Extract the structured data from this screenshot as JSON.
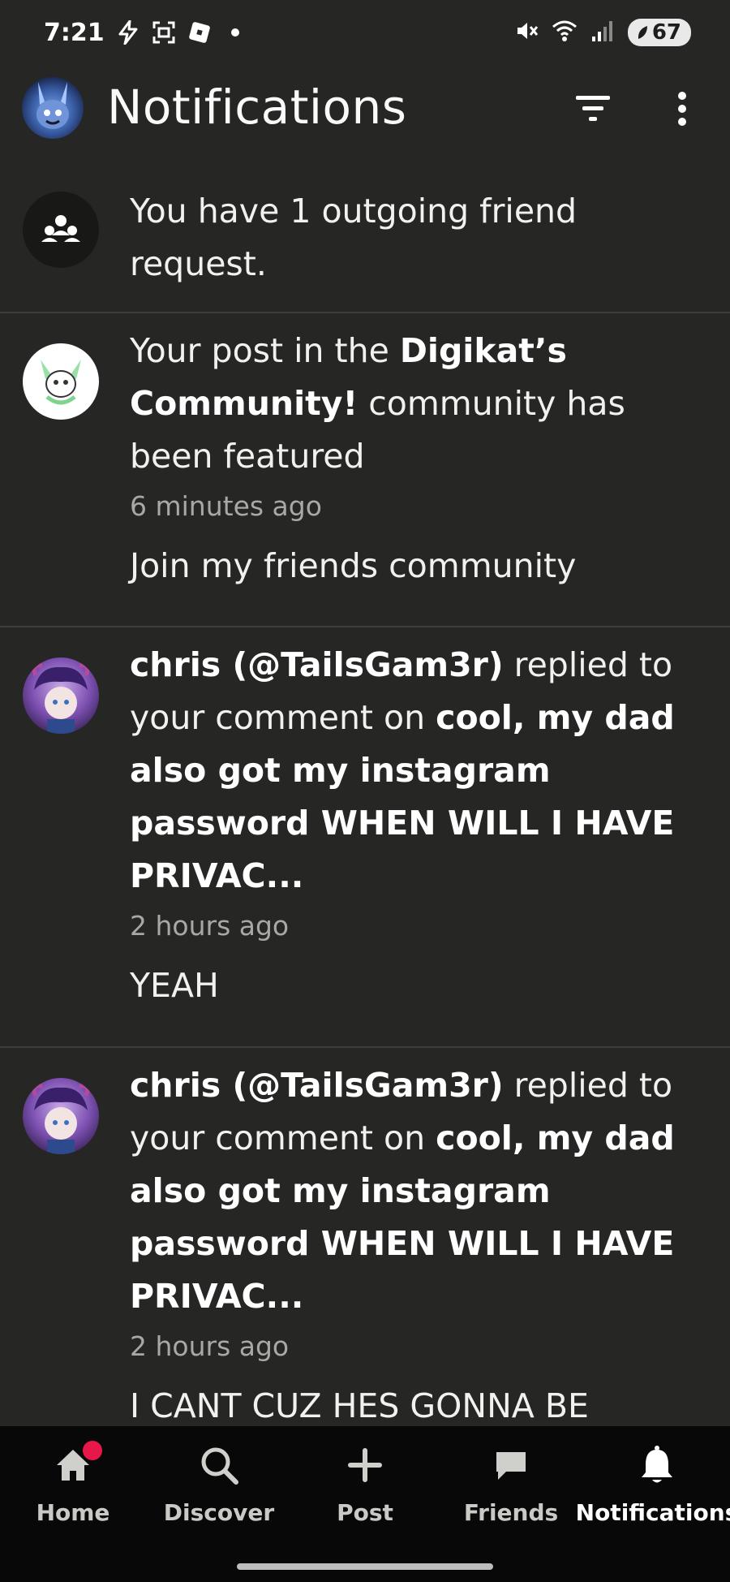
{
  "status_bar": {
    "time": "7:21",
    "battery": "67",
    "icons": [
      "flash-icon",
      "screenshot-icon",
      "roblox-icon",
      "dot-icon",
      "mute-icon",
      "wifi-icon",
      "signal-icon",
      "battery-icon"
    ]
  },
  "header": {
    "title": "Notifications",
    "actions": [
      "filter-icon",
      "more-vert-icon"
    ]
  },
  "notifications": [
    {
      "text": "You have 1 outgoing friend request."
    },
    {
      "prefix": "Your post in the ",
      "community": "Digikat’s Community!",
      "suffix": " community has been featured",
      "time": "6 minutes ago",
      "preview": "Join my friends community"
    },
    {
      "user": "chris (@TailsGam3r)",
      "action": " replied to your comment on ",
      "post": "cool, my dad also got my instagram password WHEN WILL I HAVE PRIVAC...",
      "time": "2 hours ago",
      "preview": "YEAH"
    },
    {
      "user": "chris (@TailsGam3r)",
      "action": " replied to your comment on ",
      "post": "cool, my dad also got my instagram password WHEN WILL I HAVE PRIVAC...",
      "time": "2 hours ago",
      "preview": "I CANT CUZ HES GONNA BE"
    }
  ],
  "bottom_nav": {
    "items": [
      {
        "label": "Home",
        "icon": "home-icon",
        "badge": true
      },
      {
        "label": "Discover",
        "icon": "search-icon"
      },
      {
        "label": "Post",
        "icon": "plus-icon"
      },
      {
        "label": "Friends",
        "icon": "chat-icon"
      },
      {
        "label": "Notifications",
        "icon": "bell-icon",
        "active": true
      }
    ]
  },
  "colors": {
    "background": "#262624",
    "nav_background": "#080808",
    "badge": "#e8174a",
    "muted_text": "#a8a8a4"
  }
}
